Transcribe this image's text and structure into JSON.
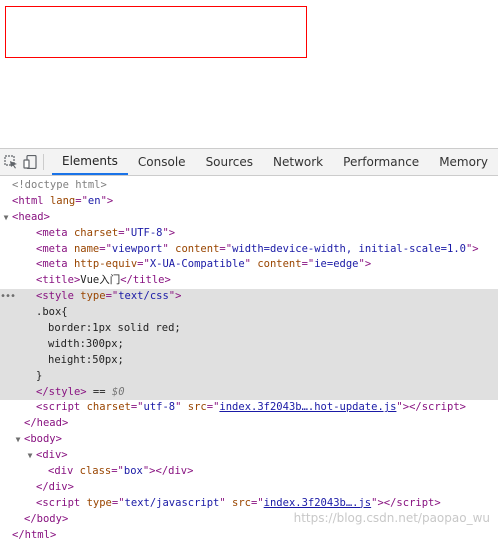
{
  "page": {
    "box_border_color": "#ff0000"
  },
  "toolbar": {
    "inspect_icon": "inspect-element-icon",
    "device_icon": "device-toggle-icon",
    "tabs": [
      "Elements",
      "Console",
      "Sources",
      "Network",
      "Performance",
      "Memory"
    ],
    "active_tab": "Elements",
    "accent_color": "#1a73e8"
  },
  "code": {
    "l1": "<!doctype html>",
    "l2_tag": "html",
    "l2_attr": "lang",
    "l2_val": "en",
    "l3_tag": "head",
    "l4_tag": "meta",
    "l4_attr": "charset",
    "l4_val": "UTF-8",
    "l5_tag": "meta",
    "l5_attr1": "name",
    "l5_val1": "viewport",
    "l5_attr2": "content",
    "l5_val2": "width=device-width, initial-scale=1.0",
    "l6_tag": "meta",
    "l6_attr1": "http-equiv",
    "l6_val1": "X-UA-Compatible",
    "l6_attr2": "content",
    "l6_val2": "ie=edge",
    "l7_tag": "title",
    "l7_text": "Vue入门",
    "l8_tag": "style",
    "l8_attr": "type",
    "l8_val": "text/css",
    "css1": ".box{",
    "css2": "border:1px solid red;",
    "css3": "width:300px;",
    "css4": "height:50px;",
    "css5": "}",
    "l14_tag": "style",
    "l14_eq": "==",
    "l14_dollar": "$0",
    "l15_tag": "script",
    "l15_attr1": "charset",
    "l15_val1": "utf-8",
    "l15_attr2": "src",
    "l15_link": "index.3f2043b….hot-update.js",
    "l16_tag": "head",
    "l17_tag": "body",
    "l18_tag": "div",
    "l19_tag": "div",
    "l19_attr": "class",
    "l19_val": "box",
    "l20_tag": "div",
    "l21_tag": "script",
    "l21_attr1": "type",
    "l21_val1": "text/javascript",
    "l21_attr2": "src",
    "l21_link": "index.3f2043b….js",
    "l22_tag": "body",
    "l23_tag": "html"
  },
  "watermark": "https://blog.csdn.net/paopao_wu"
}
